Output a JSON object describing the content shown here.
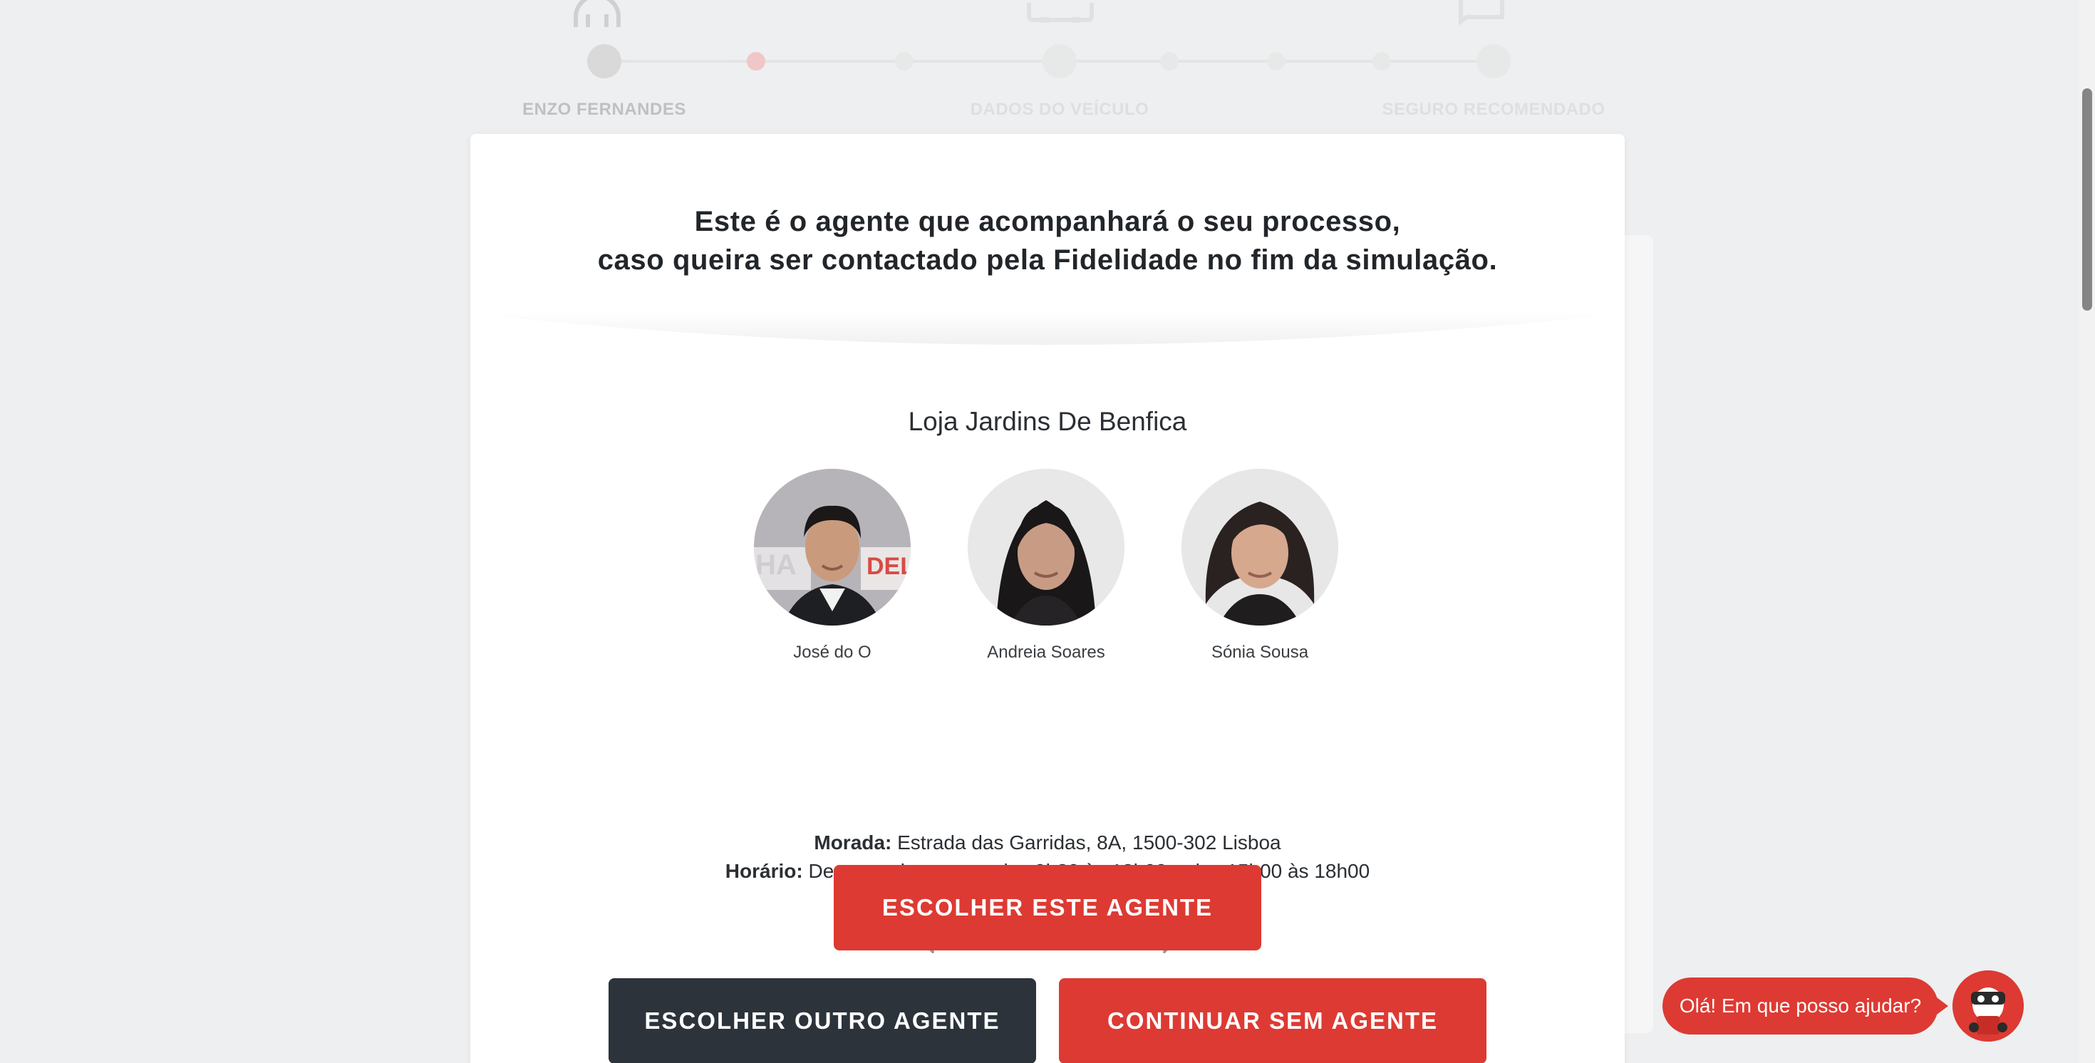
{
  "stepper": {
    "steps": [
      {
        "label": "ENZO FERNANDES",
        "status": "done",
        "icon": "headset-icon"
      },
      {
        "label": "DADOS DO VEÍCULO",
        "status": "todo",
        "icon": "car-icon"
      },
      {
        "label": "SEGURO RECOMENDADO",
        "status": "todo",
        "icon": "chat-icon"
      }
    ]
  },
  "card": {
    "title_line1": "Este é o agente que acompanhará o seu processo,",
    "title_line2": "caso queira ser contactado pela Fidelidade no fim da simulação.",
    "store_name": "Loja Jardins De Benfica",
    "agents": [
      {
        "name": "José do O"
      },
      {
        "name": "Andreia Soares"
      },
      {
        "name": "Sónia Sousa"
      }
    ],
    "address_label": "Morada:",
    "address_value": "Estrada das Garridas, 8A, 1500-302 Lisboa",
    "hours_label": "Horário:",
    "hours_value": "De segunda a sexta, das 9h30 às 13h00 e das 15h00 às 18h00",
    "carousel": {
      "pages": 5,
      "current": 1
    }
  },
  "buttons": {
    "choose_this": "ESCOLHER ESTE AGENTE",
    "choose_other": "ESCOLHER OUTRO AGENTE",
    "continue_without": "CONTINUAR SEM AGENTE"
  },
  "chat": {
    "greeting": "Olá! Em que posso ajudar?"
  },
  "colors": {
    "accent_red": "#dd3a33",
    "dark": "#2c333b",
    "background": "#eeeff0"
  }
}
